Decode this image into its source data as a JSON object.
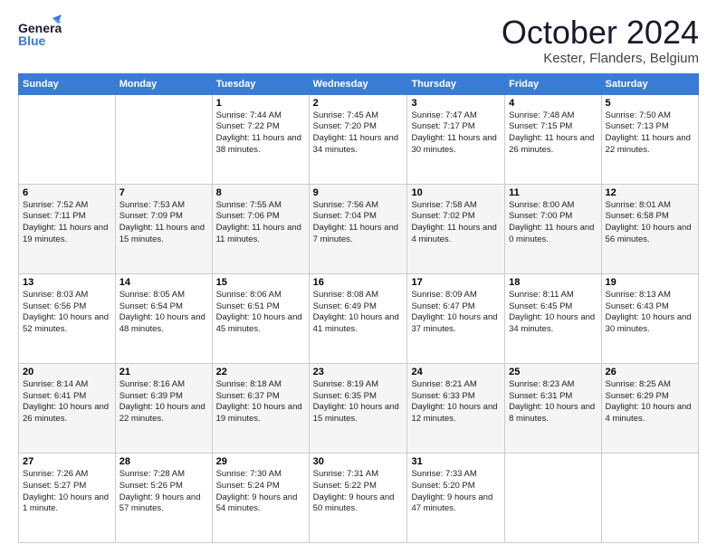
{
  "header": {
    "logo_general": "General",
    "logo_blue": "Blue",
    "month": "October 2024",
    "location": "Kester, Flanders, Belgium"
  },
  "weekdays": [
    "Sunday",
    "Monday",
    "Tuesday",
    "Wednesday",
    "Thursday",
    "Friday",
    "Saturday"
  ],
  "weeks": [
    [
      {
        "day": "",
        "info": ""
      },
      {
        "day": "",
        "info": ""
      },
      {
        "day": "1",
        "info": "Sunrise: 7:44 AM\nSunset: 7:22 PM\nDaylight: 11 hours and 38 minutes."
      },
      {
        "day": "2",
        "info": "Sunrise: 7:45 AM\nSunset: 7:20 PM\nDaylight: 11 hours and 34 minutes."
      },
      {
        "day": "3",
        "info": "Sunrise: 7:47 AM\nSunset: 7:17 PM\nDaylight: 11 hours and 30 minutes."
      },
      {
        "day": "4",
        "info": "Sunrise: 7:48 AM\nSunset: 7:15 PM\nDaylight: 11 hours and 26 minutes."
      },
      {
        "day": "5",
        "info": "Sunrise: 7:50 AM\nSunset: 7:13 PM\nDaylight: 11 hours and 22 minutes."
      }
    ],
    [
      {
        "day": "6",
        "info": "Sunrise: 7:52 AM\nSunset: 7:11 PM\nDaylight: 11 hours and 19 minutes."
      },
      {
        "day": "7",
        "info": "Sunrise: 7:53 AM\nSunset: 7:09 PM\nDaylight: 11 hours and 15 minutes."
      },
      {
        "day": "8",
        "info": "Sunrise: 7:55 AM\nSunset: 7:06 PM\nDaylight: 11 hours and 11 minutes."
      },
      {
        "day": "9",
        "info": "Sunrise: 7:56 AM\nSunset: 7:04 PM\nDaylight: 11 hours and 7 minutes."
      },
      {
        "day": "10",
        "info": "Sunrise: 7:58 AM\nSunset: 7:02 PM\nDaylight: 11 hours and 4 minutes."
      },
      {
        "day": "11",
        "info": "Sunrise: 8:00 AM\nSunset: 7:00 PM\nDaylight: 11 hours and 0 minutes."
      },
      {
        "day": "12",
        "info": "Sunrise: 8:01 AM\nSunset: 6:58 PM\nDaylight: 10 hours and 56 minutes."
      }
    ],
    [
      {
        "day": "13",
        "info": "Sunrise: 8:03 AM\nSunset: 6:56 PM\nDaylight: 10 hours and 52 minutes."
      },
      {
        "day": "14",
        "info": "Sunrise: 8:05 AM\nSunset: 6:54 PM\nDaylight: 10 hours and 48 minutes."
      },
      {
        "day": "15",
        "info": "Sunrise: 8:06 AM\nSunset: 6:51 PM\nDaylight: 10 hours and 45 minutes."
      },
      {
        "day": "16",
        "info": "Sunrise: 8:08 AM\nSunset: 6:49 PM\nDaylight: 10 hours and 41 minutes."
      },
      {
        "day": "17",
        "info": "Sunrise: 8:09 AM\nSunset: 6:47 PM\nDaylight: 10 hours and 37 minutes."
      },
      {
        "day": "18",
        "info": "Sunrise: 8:11 AM\nSunset: 6:45 PM\nDaylight: 10 hours and 34 minutes."
      },
      {
        "day": "19",
        "info": "Sunrise: 8:13 AM\nSunset: 6:43 PM\nDaylight: 10 hours and 30 minutes."
      }
    ],
    [
      {
        "day": "20",
        "info": "Sunrise: 8:14 AM\nSunset: 6:41 PM\nDaylight: 10 hours and 26 minutes."
      },
      {
        "day": "21",
        "info": "Sunrise: 8:16 AM\nSunset: 6:39 PM\nDaylight: 10 hours and 22 minutes."
      },
      {
        "day": "22",
        "info": "Sunrise: 8:18 AM\nSunset: 6:37 PM\nDaylight: 10 hours and 19 minutes."
      },
      {
        "day": "23",
        "info": "Sunrise: 8:19 AM\nSunset: 6:35 PM\nDaylight: 10 hours and 15 minutes."
      },
      {
        "day": "24",
        "info": "Sunrise: 8:21 AM\nSunset: 6:33 PM\nDaylight: 10 hours and 12 minutes."
      },
      {
        "day": "25",
        "info": "Sunrise: 8:23 AM\nSunset: 6:31 PM\nDaylight: 10 hours and 8 minutes."
      },
      {
        "day": "26",
        "info": "Sunrise: 8:25 AM\nSunset: 6:29 PM\nDaylight: 10 hours and 4 minutes."
      }
    ],
    [
      {
        "day": "27",
        "info": "Sunrise: 7:26 AM\nSunset: 5:27 PM\nDaylight: 10 hours and 1 minute."
      },
      {
        "day": "28",
        "info": "Sunrise: 7:28 AM\nSunset: 5:26 PM\nDaylight: 9 hours and 57 minutes."
      },
      {
        "day": "29",
        "info": "Sunrise: 7:30 AM\nSunset: 5:24 PM\nDaylight: 9 hours and 54 minutes."
      },
      {
        "day": "30",
        "info": "Sunrise: 7:31 AM\nSunset: 5:22 PM\nDaylight: 9 hours and 50 minutes."
      },
      {
        "day": "31",
        "info": "Sunrise: 7:33 AM\nSunset: 5:20 PM\nDaylight: 9 hours and 47 minutes."
      },
      {
        "day": "",
        "info": ""
      },
      {
        "day": "",
        "info": ""
      }
    ]
  ]
}
